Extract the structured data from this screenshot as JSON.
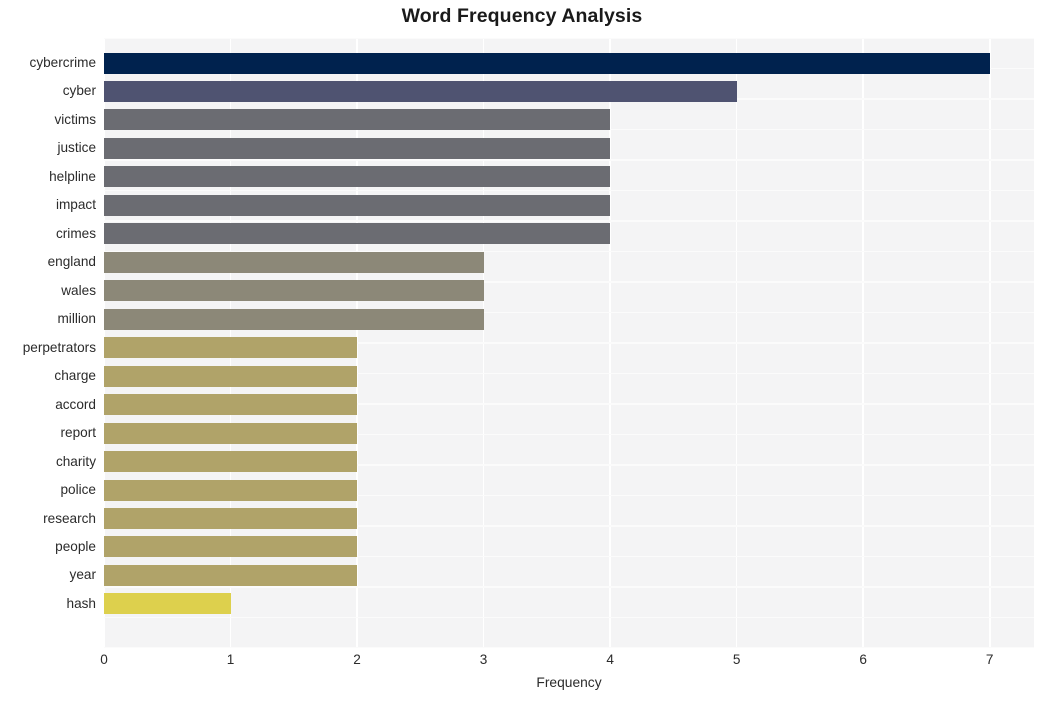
{
  "chart_data": {
    "type": "bar",
    "orientation": "horizontal",
    "title": "Word Frequency Analysis",
    "xlabel": "Frequency",
    "ylabel": "",
    "xlim": [
      0,
      7.35
    ],
    "xticks": [
      0,
      1,
      2,
      3,
      4,
      5,
      6,
      7
    ],
    "xtick_labels": [
      "0",
      "1",
      "2",
      "3",
      "4",
      "5",
      "6",
      "7"
    ],
    "grid": true,
    "legend": false,
    "categories": [
      "cybercrime",
      "cyber",
      "victims",
      "justice",
      "helpline",
      "impact",
      "crimes",
      "england",
      "wales",
      "million",
      "perpetrators",
      "charge",
      "accord",
      "report",
      "charity",
      "police",
      "research",
      "people",
      "year",
      "hash"
    ],
    "values": [
      7,
      5,
      4,
      4,
      4,
      4,
      4,
      3,
      3,
      3,
      2,
      2,
      2,
      2,
      2,
      2,
      2,
      2,
      2,
      1
    ],
    "bar_colors": [
      "#00224e",
      "#4f5371",
      "#6b6c72",
      "#6b6c72",
      "#6b6c72",
      "#6b6c72",
      "#6b6c72",
      "#8c8878",
      "#8c8878",
      "#8c8878",
      "#b0a369",
      "#b0a369",
      "#b0a369",
      "#b0a369",
      "#b0a369",
      "#b0a369",
      "#b0a369",
      "#b0a369",
      "#b0a369",
      "#ddd04d"
    ],
    "colormap": "cividis",
    "plot_background": "#f4f4f5",
    "gridline_color": "#ffffff",
    "text_color": "#2b2b2b"
  }
}
